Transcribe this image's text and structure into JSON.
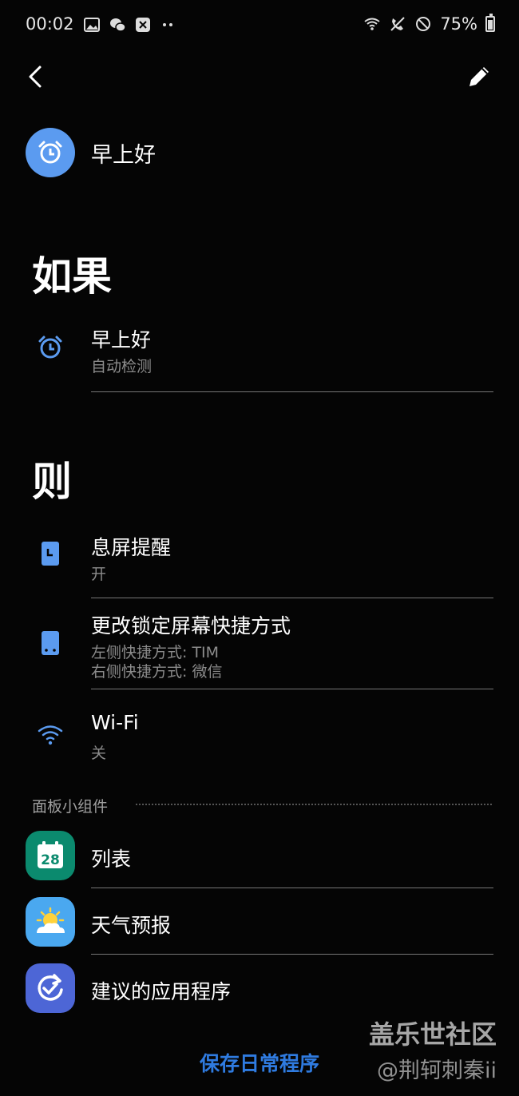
{
  "status_bar": {
    "time": "00:02",
    "battery": "75%",
    "left_icons": [
      "gallery-icon",
      "wechat-icon",
      "app-icon",
      "more-dots-icon"
    ],
    "right_icons": [
      "wifi-icon",
      "call-icon",
      "do-not-disturb-icon",
      "battery-icon"
    ]
  },
  "header": {
    "back_icon": "back-arrow-icon",
    "edit_icon": "pencil-icon"
  },
  "routine": {
    "name": "早上好",
    "icon": "alarm-clock-icon",
    "icon_color": "#5b9bf0"
  },
  "if_section": {
    "title": "如果",
    "items": [
      {
        "title": "早上好",
        "subtitle": "自动检测",
        "icon": "alarm-clock-icon"
      }
    ]
  },
  "then_section": {
    "title": "则",
    "items": [
      {
        "title": "息屏提醒",
        "subtitle": "开",
        "icon": "always-on-display-icon"
      },
      {
        "title": "更改锁定屏幕快捷方式",
        "subtitle1": "左侧快捷方式: TIM",
        "subtitle2": "右侧快捷方式: 微信",
        "icon": "phone-icon"
      },
      {
        "title": "Wi-Fi",
        "subtitle": "关",
        "icon": "wifi-icon"
      }
    ]
  },
  "widgets": {
    "label": "面板小组件",
    "items": [
      {
        "title": "列表",
        "icon": "calendar-icon",
        "badge": "28",
        "color": "#0b8a6e"
      },
      {
        "title": "天气预报",
        "icon": "weather-icon",
        "color": "#4aa8f0"
      },
      {
        "title": "建议的应用程序",
        "icon": "suggested-apps-icon",
        "color": "#4d66d6"
      }
    ]
  },
  "save_button": "保存日常程序",
  "watermark": {
    "line1": "盖乐世社区",
    "line2": "@荆轲刺秦ii"
  },
  "accent_color": "#2f7be0"
}
